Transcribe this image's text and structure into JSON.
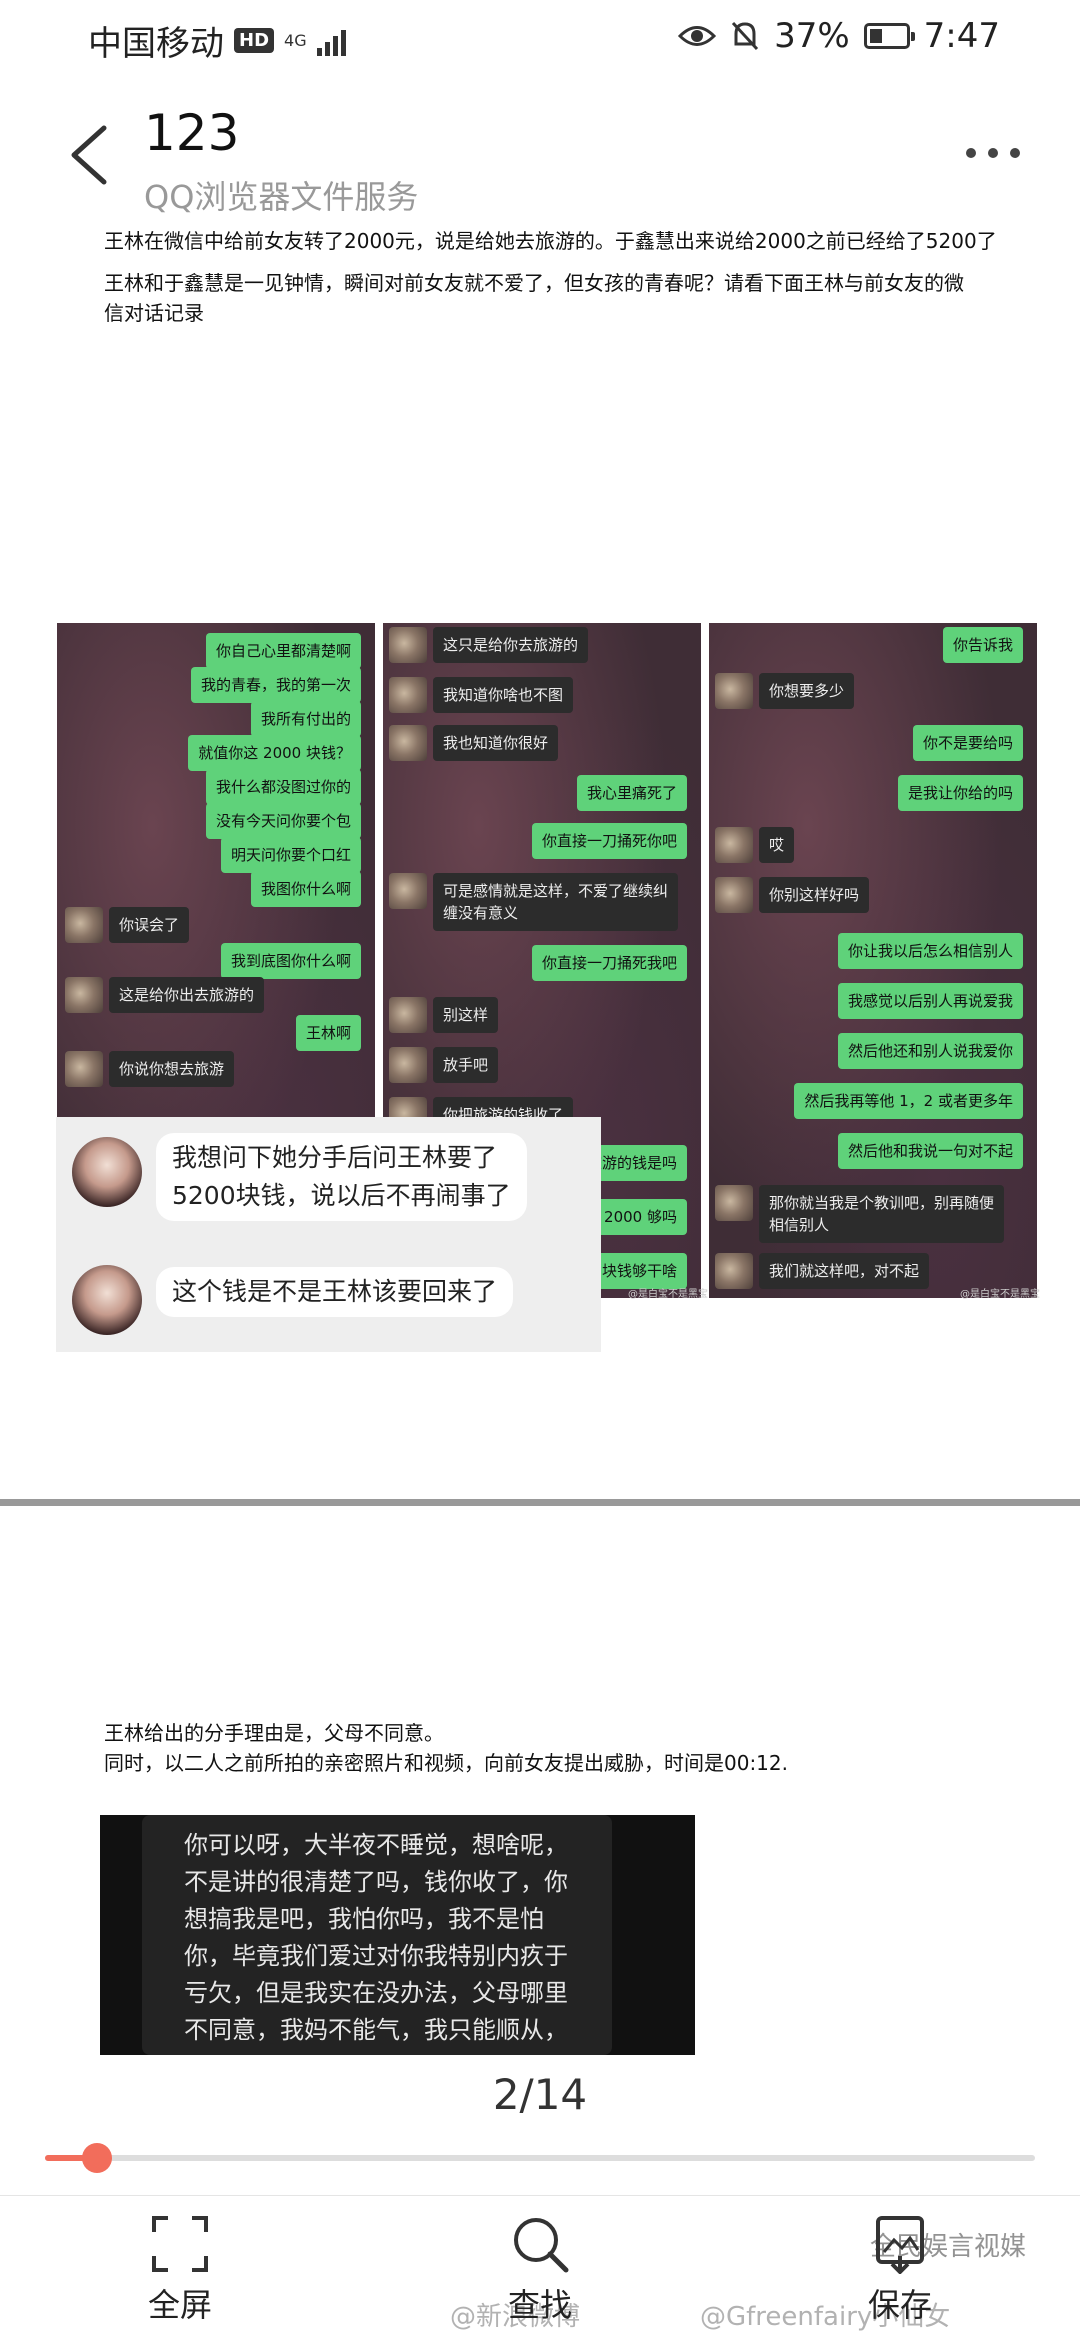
{
  "status_bar": {
    "carrier": "中国移动",
    "hd": "HD",
    "network": "4G",
    "percent": "37%",
    "time": "7:47",
    "battery_level": 0.37
  },
  "header": {
    "title": "123",
    "subtitle": "QQ浏览器文件服务"
  },
  "doc": {
    "para1": "王林在微信中给前女友转了2000元，说是给她去旅游的。于鑫慧出来说给2000之前已经给了5200了",
    "para2a": "王林和于鑫慧是一见钟情，瞬间对前女友就不爱了，但女孩的青春呢？请看下面王林与前女友的微",
    "para2b": "信对话记录",
    "chat1": [
      "你自己心里都清楚啊",
      "我的青春，我的第一次",
      "我所有付出的",
      "就值你这 2000 块钱？",
      "我什么都没图过你的",
      "没有今天问你要个包",
      "明天问你要个口红",
      "我图你什么啊",
      "你误会了",
      "我到底图你什么啊",
      "这是给你出去旅游的",
      "王林啊",
      "你说你想去旅游"
    ],
    "chat2": [
      "这只是给你去旅游的",
      "我知道你啥也不图",
      "我也知道你很好",
      "我心里痛死了",
      "你直接一刀捅死你吧",
      "可是感情就是这样，不爱了继续纠",
      "缠没有意义",
      "你直接一刀捅死我吧",
      "别这样",
      "放手吧",
      "你把旅游的钱收了",
      "你是要给我旅游的钱是吗",
      "2000 够吗",
      "2000 块钱够干啥"
    ],
    "chat3": [
      "你告诉我",
      "你想要多少",
      "你不是要给吗",
      "是我让你给的吗",
      "哎",
      "你别这样好吗",
      "你让我以后怎么相信别人",
      "我感觉以后别人再说爱我",
      "然后他还和别人说我爱你",
      "然后我再等他 1，2 或者更多年",
      "然后他和我说一句对不起",
      "那你就当我是个教训吧，别再随便",
      "相信别人",
      "我们就这样吧，对不起"
    ],
    "watermarks": [
      "@是白宝不是黑宝",
      "@是白宝不是黑宝",
      "@是白宝不是黑宝"
    ],
    "comment1a": "我想问下她分手后问王林要了",
    "comment1b": "5200块钱，说以后不再闹事了",
    "comment2": "这个钱是不是王林该要回来了",
    "para3": "王林给出的分手理由是，父母不同意。",
    "para4": "同时，以二人之前所拍的亲密照片和视频，向前女友提出威胁，时间是00:12.",
    "dark_lines": [
      "你可以呀，大半夜不睡觉，想啥呢，",
      "不是讲的很清楚了吗，钱你收了，你",
      "想搞我是吧，我怕你吗，我不是怕",
      "你，毕竟我们爱过对你我特别内疚于",
      "亏欠，但是我实在没办法，父母哪里",
      "不同意，我妈不能气，我只能顺从，"
    ]
  },
  "pager": {
    "label": "2/14",
    "progress": 0.053
  },
  "toolbar": {
    "fullscreen": "全屏",
    "find": "查找",
    "save": "保存",
    "ghost1": "@新浪微博",
    "ghost2": "@Gfreenfairy小仙女",
    "ghost3": "全民娱言视媒"
  },
  "colors": {
    "accent": "#f26d5b",
    "bubble_green": "#5fd27a",
    "bubble_dark": "#2c2c2c"
  }
}
